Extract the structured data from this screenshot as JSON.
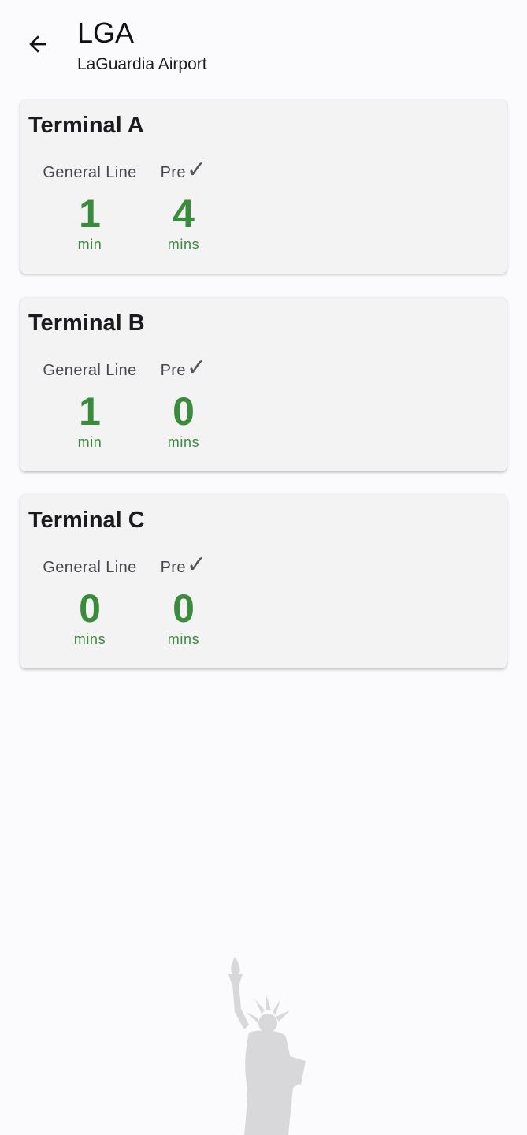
{
  "header": {
    "back_icon": "arrow-back-icon",
    "title": "LGA",
    "subtitle": "LaGuardia Airport"
  },
  "terminals": [
    {
      "name": "Terminal A",
      "general_label": "General Line",
      "general_value": "1",
      "general_unit": "min",
      "pre_label": "Pre",
      "pre_value": "4",
      "pre_unit": "mins"
    },
    {
      "name": "Terminal B",
      "general_label": "General Line",
      "general_value": "1",
      "general_unit": "min",
      "pre_label": "Pre",
      "pre_value": "0",
      "pre_unit": "mins"
    },
    {
      "name": "Terminal C",
      "general_label": "General Line",
      "general_value": "0",
      "general_unit": "mins",
      "pre_label": "Pre",
      "pre_value": "0",
      "pre_unit": "mins"
    }
  ],
  "colors": {
    "accent_green": "#3a8b3c",
    "card_background": "#f3f3f4",
    "page_background": "#fbfbfd"
  },
  "decoration": {
    "footer_image": "statue-of-liberty-illustration"
  }
}
